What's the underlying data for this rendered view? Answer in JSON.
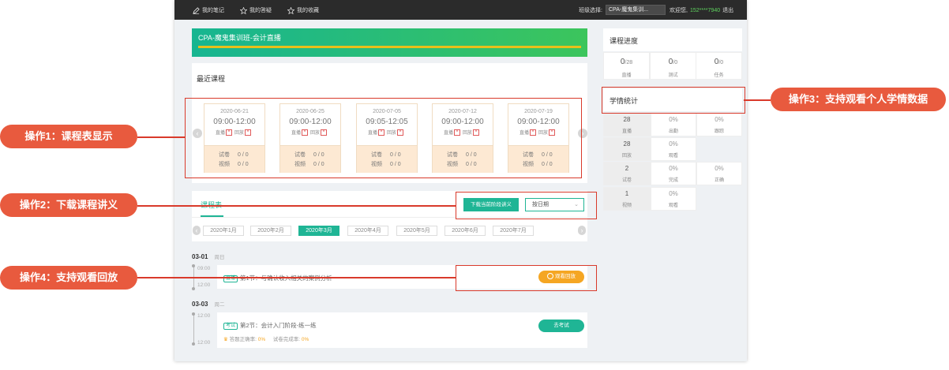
{
  "nav": {
    "notes": "我的笔记",
    "answers": "我的答疑",
    "favorites": "我的收藏",
    "class_select_label": "班级选择:",
    "class_select_value": "CPA-魔鬼集训...",
    "welcome": "欢迎您,",
    "phone": "152****7940",
    "logout": "退出"
  },
  "course": {
    "title": "CPA-魔鬼集训班-会计直播",
    "recent_title": "最近课程",
    "cards": [
      {
        "date": "2020-06-21",
        "time": "09:00-12:00",
        "live": "直播",
        "replay": "回放",
        "exam": "试卷",
        "exam_val": "0 / 0",
        "video": "视频",
        "video_val": "0 / 0"
      },
      {
        "date": "2020-06-25",
        "time": "09:00-12:00",
        "live": "直播",
        "replay": "回放",
        "exam": "试卷",
        "exam_val": "0 / 0",
        "video": "视频",
        "video_val": "0 / 0"
      },
      {
        "date": "2020-07-05",
        "time": "09:05-12:05",
        "live": "直播",
        "replay": "回放",
        "exam": "试卷",
        "exam_val": "0 / 0",
        "video": "视频",
        "video_val": "0 / 0"
      },
      {
        "date": "2020-07-12",
        "time": "09:00-12:00",
        "live": "直播",
        "replay": "回放",
        "exam": "试卷",
        "exam_val": "0 / 0",
        "video": "视频",
        "video_val": "0 / 0"
      },
      {
        "date": "2020-07-19",
        "time": "09:00-12:00",
        "live": "直播",
        "replay": "回放",
        "exam": "试卷",
        "exam_val": "0 / 0",
        "video": "视频",
        "video_val": "0 / 0"
      }
    ]
  },
  "schedule": {
    "tab": "课程表",
    "download_btn": "下载当前阶段讲义",
    "sort_select": "按日期",
    "months": [
      "2020年1月",
      "2020年2月",
      "2020年3月",
      "2020年4月",
      "2020年5月",
      "2020年6月",
      "2020年7月"
    ],
    "active_month": "2020年3月",
    "days": [
      {
        "date": "03-01",
        "weekday": "周日",
        "start": "09:00",
        "end": "12:00",
        "tag": "直播",
        "lesson": "第1节：与确认收入相关的案例分析",
        "action": "观看回放"
      },
      {
        "date": "03-03",
        "weekday": "周二",
        "start": "12:00",
        "end": "12:00",
        "tag": "考试",
        "lesson": "第2节：会计入门阶段-练一练",
        "action": "去考试",
        "accuracy_label": "答题正确率:",
        "accuracy": "0%",
        "completion_label": "试卷完成率:",
        "completion": "0%"
      }
    ]
  },
  "progress": {
    "title": "课程进度",
    "items": [
      {
        "num": "0",
        "den": "/28",
        "label": "直播"
      },
      {
        "num": "0",
        "den": "/0",
        "label": "测试"
      },
      {
        "num": "0",
        "den": "/0",
        "label": "任务"
      }
    ]
  },
  "stats": {
    "title": "学情统计",
    "rows": [
      {
        "head": "28",
        "head_label": "直播",
        "cells": [
          {
            "v": "0%",
            "l": "出勤"
          },
          {
            "v": "0%",
            "l": "跟踪"
          }
        ]
      },
      {
        "head": "28",
        "head_label": "回放",
        "cells": [
          {
            "v": "0%",
            "l": "观看"
          }
        ]
      },
      {
        "head": "2",
        "head_label": "试卷",
        "cells": [
          {
            "v": "0%",
            "l": "完成"
          },
          {
            "v": "0%",
            "l": "正确"
          }
        ]
      },
      {
        "head": "1",
        "head_label": "视频",
        "cells": [
          {
            "v": "0%",
            "l": "观看"
          }
        ]
      }
    ]
  },
  "annotations": {
    "op1": "操作1：课程表显示",
    "op2": "操作2：下载课程讲义",
    "op3": "操作3：支持观看个人学情数据",
    "op4": "操作4：支持观看回放"
  },
  "colors": {
    "accent": "#1fb595",
    "annotation": "#e85a3e",
    "orange": "#f5a623"
  }
}
